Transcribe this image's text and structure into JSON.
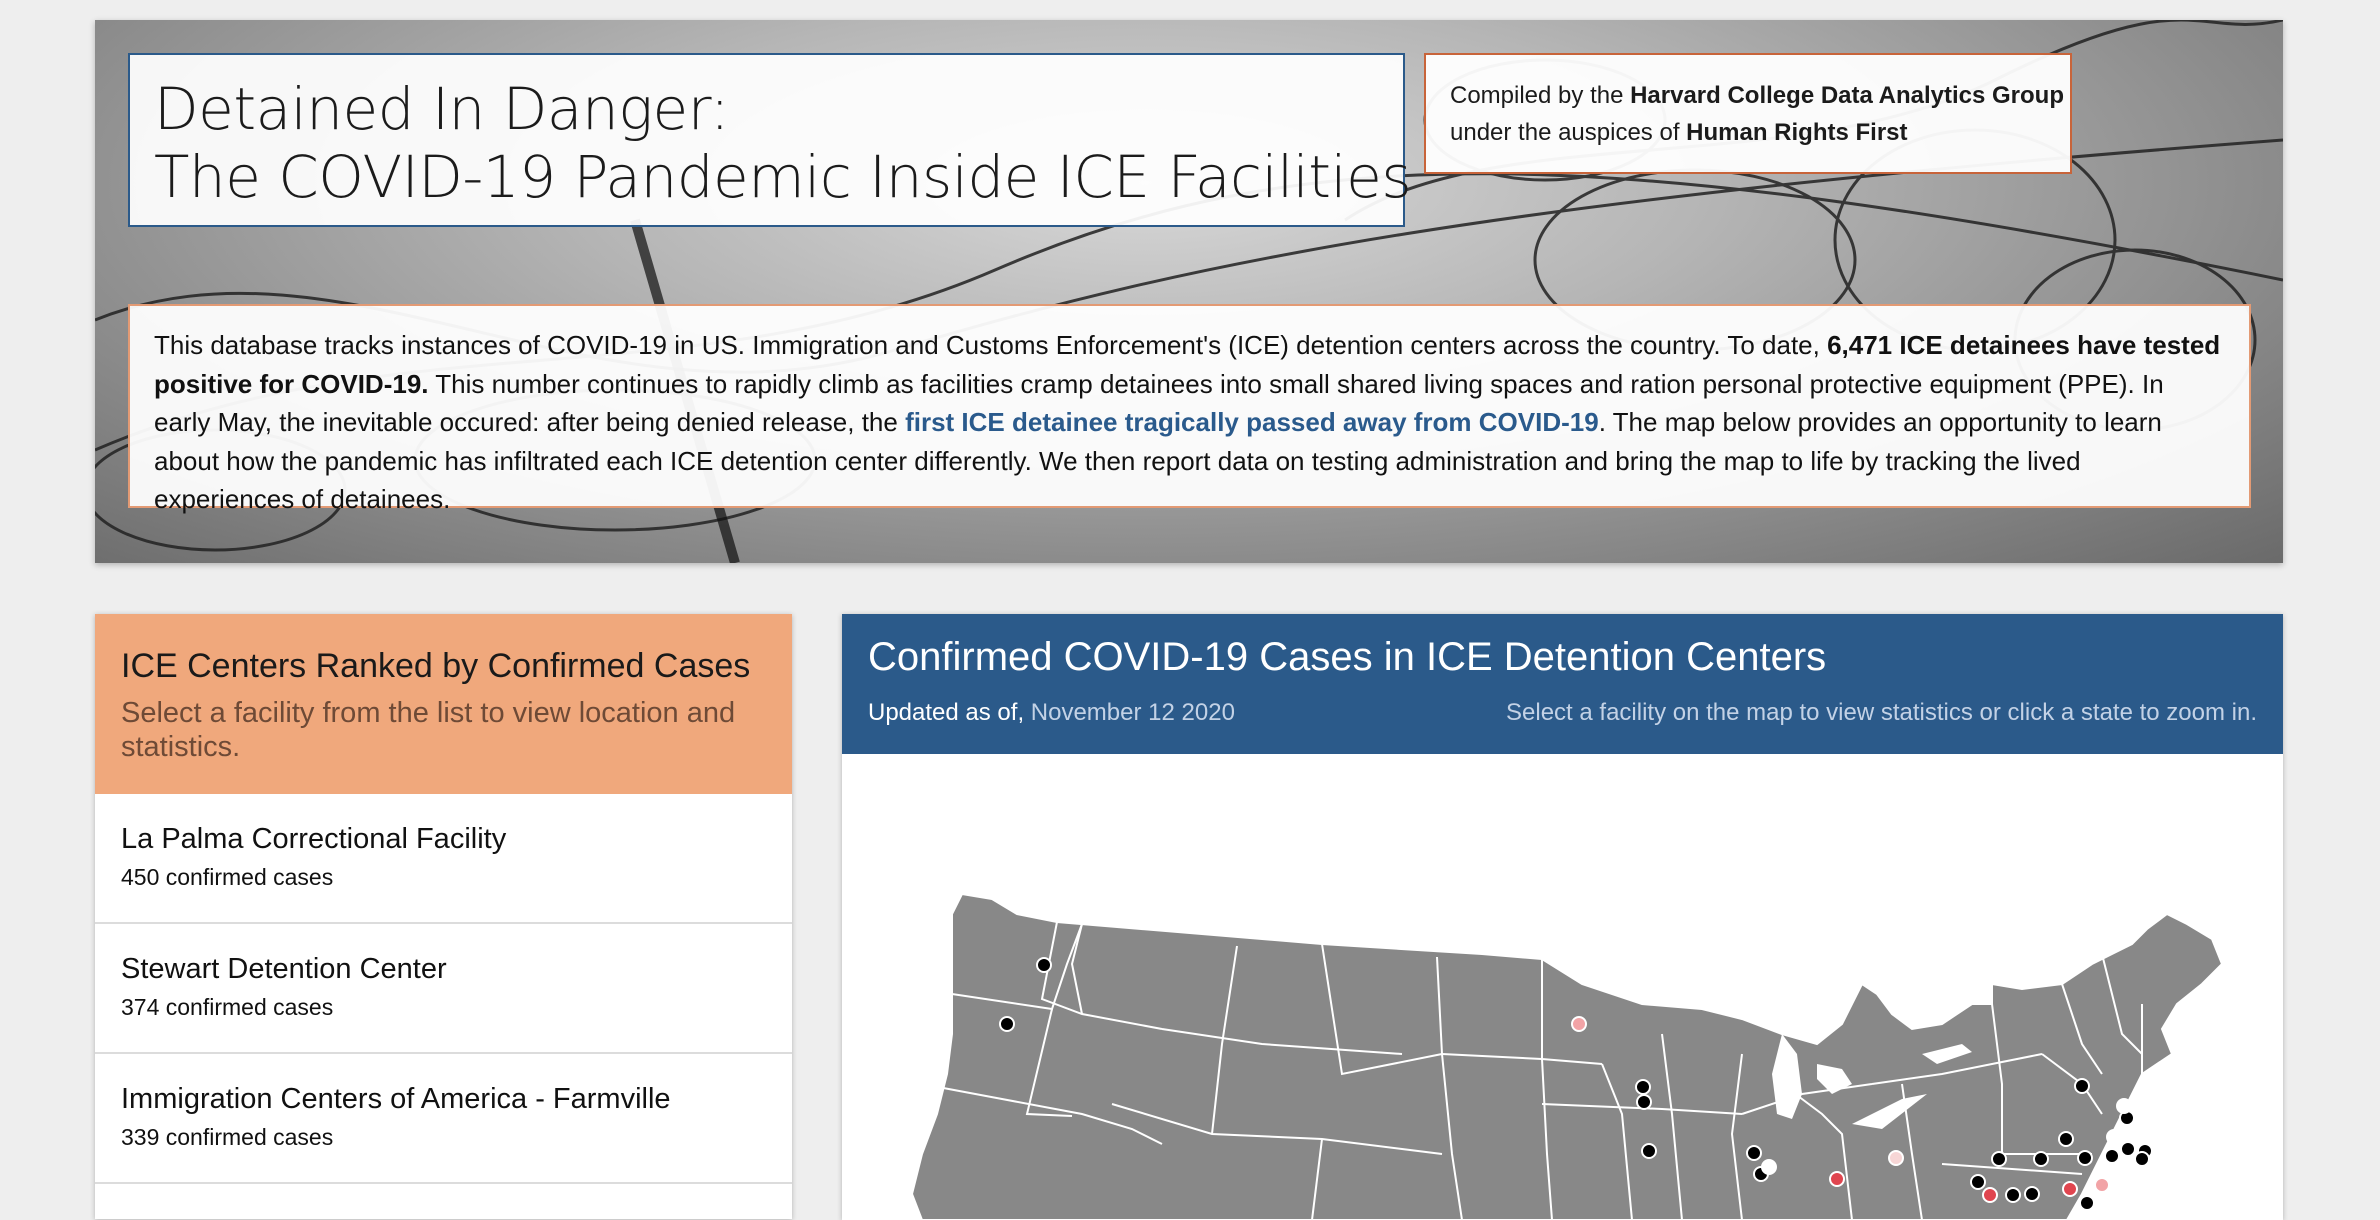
{
  "hero": {
    "title_line1": "Detained In Danger:",
    "title_line2": "The COVID-19 Pandemic Inside ICE Facilities",
    "compiled": {
      "prefix": "Compiled by the ",
      "group": "Harvard College Data Analytics Group",
      "middle": "under the auspices of ",
      "org": "Human Rights First"
    },
    "description": {
      "part1": "This database tracks instances of COVID-19 in US. Immigration and Customs Enforcement's (ICE) detention centers across the country. To date, ",
      "bold": "6,471 ICE detainees have tested positive for COVID-19.",
      "part2": " This number continues to rapidly climb as facilities cramp detainees into small shared living spaces and ration personal protective equipment (PPE). In early May, the inevitable occured: after being denied release, the ",
      "link": "first ICE detainee tragically passed away from COVID-19",
      "part3": ". The map below provides an opportunity to learn about how the pandemic has infiltrated each ICE detention center differently. We then report data on testing administration and bring the map to life by tracking the lived experiences of detainees."
    }
  },
  "ranking": {
    "title": "ICE Centers Ranked by Confirmed Cases",
    "subtitle": "Select a facility from the list to view location and statistics.",
    "items": [
      {
        "name": "La Palma Correctional Facility",
        "count": "450 confirmed cases"
      },
      {
        "name": "Stewart Detention Center",
        "count": "374 confirmed cases"
      },
      {
        "name": "Immigration Centers of America - Farmville",
        "count": "339 confirmed cases"
      }
    ]
  },
  "map": {
    "title": "Confirmed COVID-19 Cases in ICE Detention Centers",
    "updated_label": "Updated as of,",
    "updated_date": "November 12 2020",
    "instructions": "Select a facility on the map to view statistics or click a state to zoom in.",
    "colors": {
      "land": "#888888",
      "border": "#ffffff",
      "marker_default": "#000000",
      "marker_high": "#e0454f",
      "marker_medium": "#f2a3a6",
      "marker_low": "#f7d6d6"
    }
  },
  "colors": {
    "header_blue": "#2b5a8a",
    "ranking_header": "#f0a87c",
    "title_border": "#2b5a8a",
    "compiled_border": "#c8643a"
  }
}
